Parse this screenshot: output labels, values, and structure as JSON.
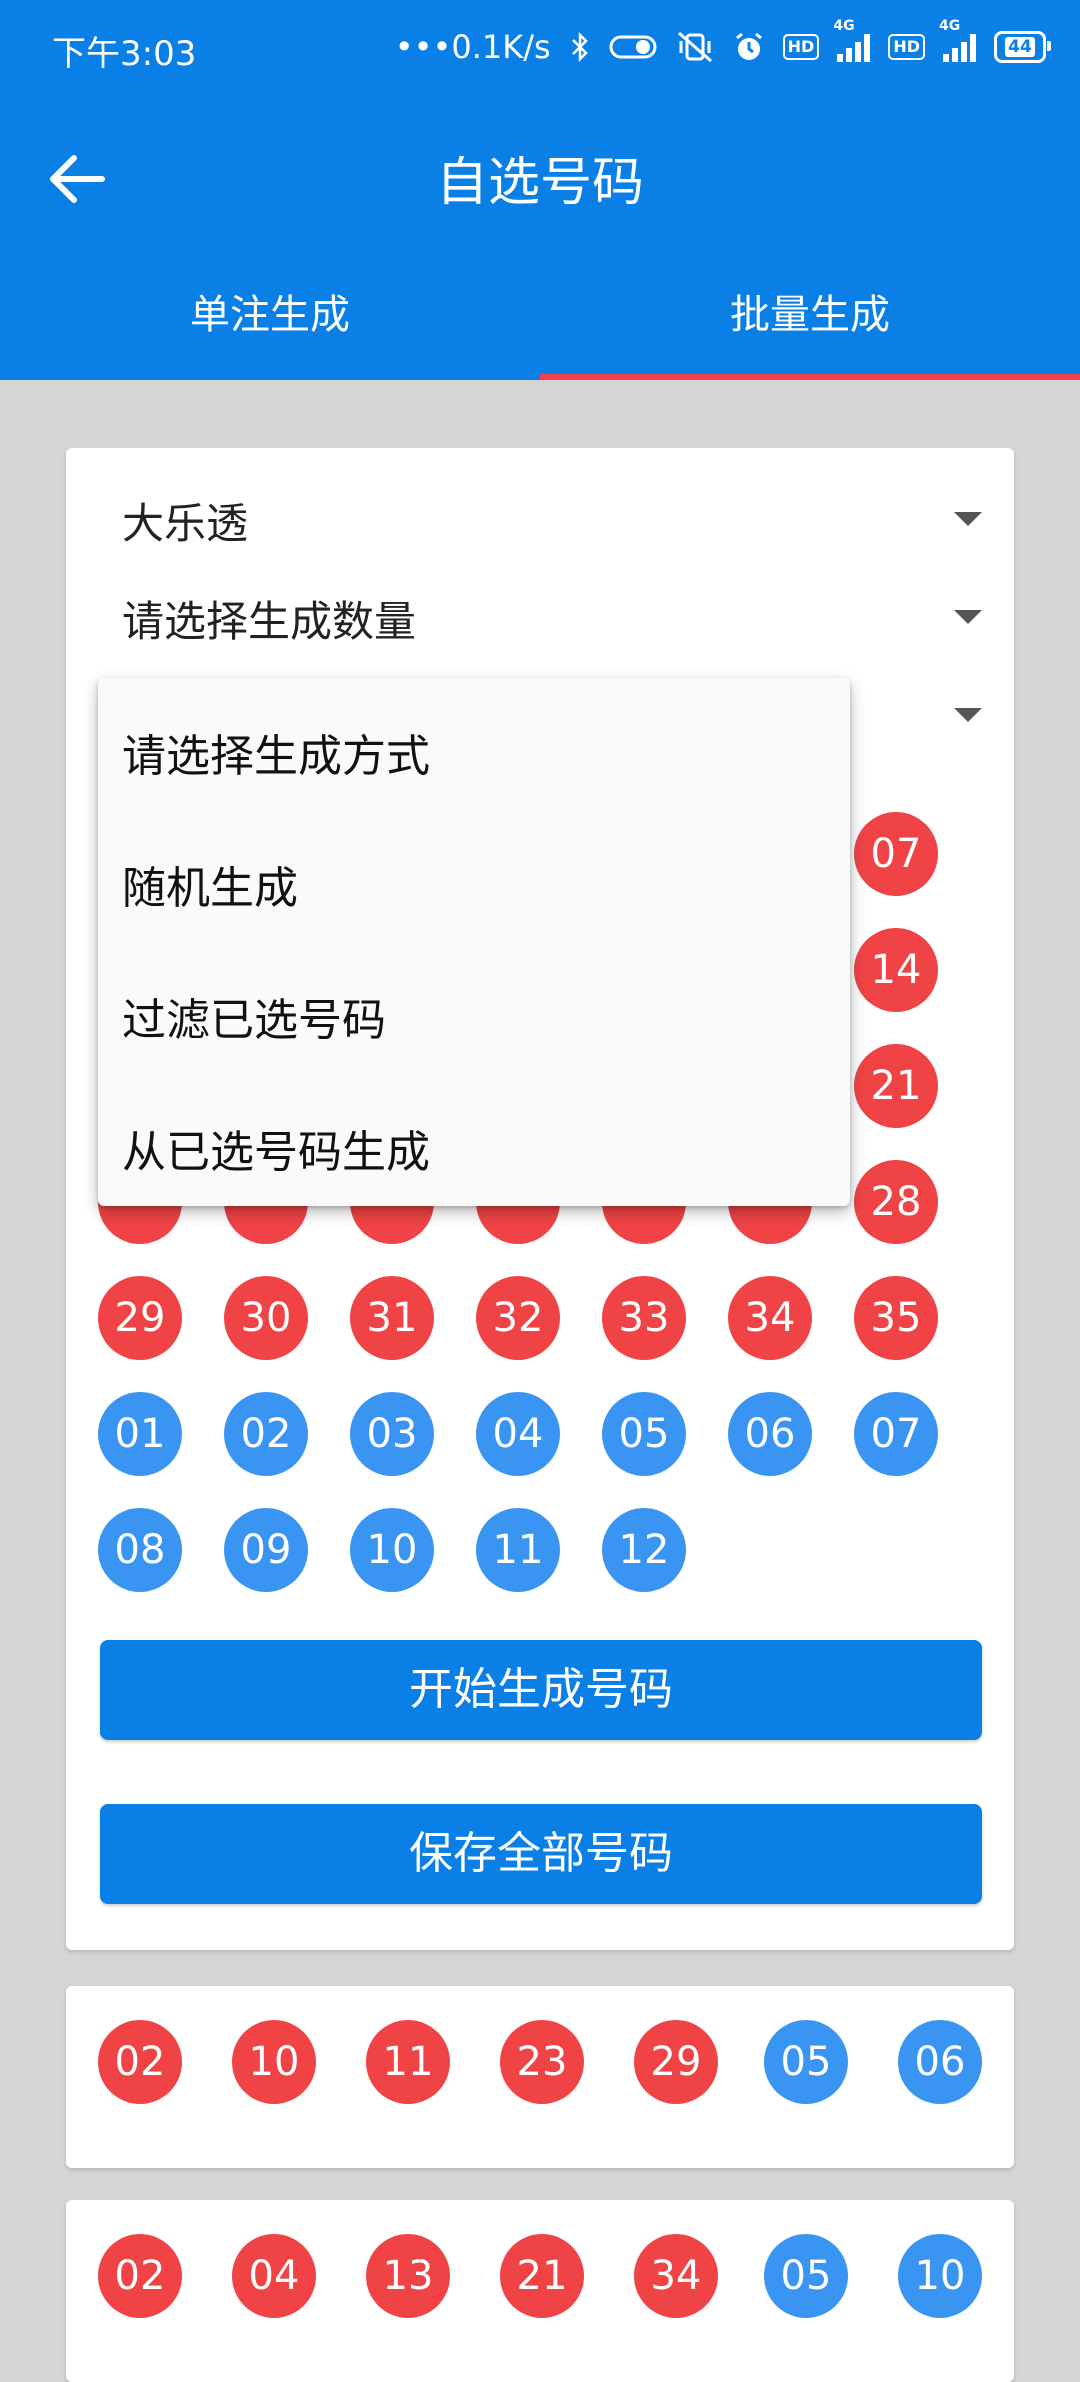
{
  "status": {
    "time": "下午3:03",
    "net_speed": "0.1K/s",
    "battery": "44"
  },
  "header": {
    "title": "自选号码",
    "tabs": [
      {
        "label": "单注生成",
        "active": false
      },
      {
        "label": "批量生成",
        "active": true
      }
    ]
  },
  "form": {
    "lottery": "大乐透",
    "quantity_placeholder": "请选择生成数量",
    "generate_button": "开始生成号码",
    "save_button": "保存全部号码"
  },
  "dropdown": {
    "options": [
      "请选择生成方式",
      "随机生成",
      "过滤已选号码",
      "从已选号码生成"
    ]
  },
  "number_grid": {
    "front_visible": [
      "07",
      "14",
      "21",
      "28",
      "29",
      "30",
      "31",
      "32",
      "33",
      "34",
      "35"
    ],
    "back": [
      "01",
      "02",
      "03",
      "04",
      "05",
      "06",
      "07",
      "08",
      "09",
      "10",
      "11",
      "12"
    ]
  },
  "results": [
    {
      "front": [
        "02",
        "10",
        "11",
        "23",
        "29"
      ],
      "back": [
        "05",
        "06"
      ]
    },
    {
      "front": [
        "02",
        "04",
        "13",
        "21",
        "34"
      ],
      "back": [
        "05",
        "10"
      ]
    }
  ],
  "colors": {
    "primary": "#0a80e6",
    "tab_indicator": "#f0424a",
    "front_ball": "#f04346",
    "back_ball": "#3a95f2"
  }
}
